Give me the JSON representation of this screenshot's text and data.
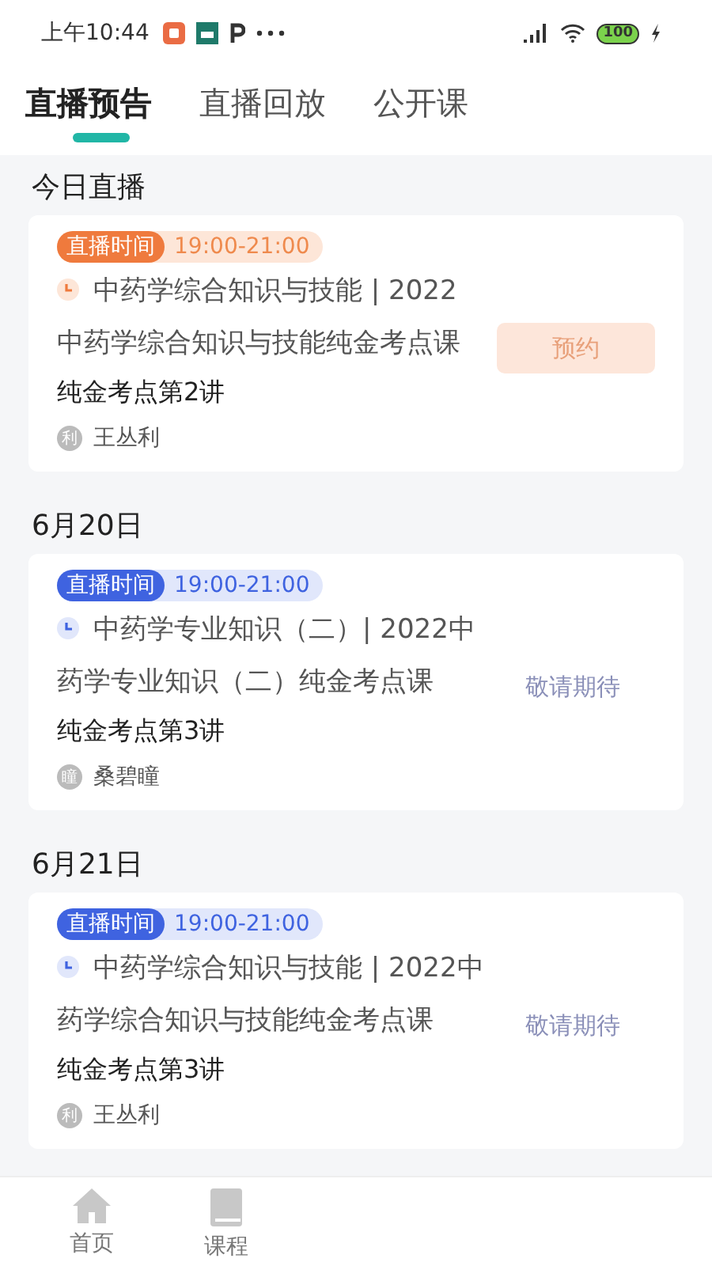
{
  "status_bar": {
    "time": "上午10:44",
    "battery": "100"
  },
  "tabs": [
    {
      "label": "直播预告",
      "selected": true
    },
    {
      "label": "直播回放",
      "selected": false
    },
    {
      "label": "公开课",
      "selected": false
    }
  ],
  "sections": [
    {
      "title": "今日直播",
      "lessons": [
        {
          "kind": "bookable",
          "tag": "直播时间",
          "time": "19:00-21:00",
          "course": "中药学综合知识与技能 | 2022中药学综合知识与技能纯金考点课",
          "lecture": "纯金考点第2讲",
          "avatar": "利",
          "teacher": "王丛利",
          "action": "预约"
        }
      ]
    },
    {
      "title": "6月20日",
      "lessons": [
        {
          "kind": "upcoming",
          "tag": "直播时间",
          "time": "19:00-21:00",
          "course": "中药学专业知识（二）| 2022中药学专业知识（二）纯金考点课",
          "lecture": "纯金考点第3讲",
          "avatar": "瞳",
          "teacher": "桑碧瞳",
          "action": "敬请期待"
        }
      ]
    },
    {
      "title": "6月21日",
      "lessons": [
        {
          "kind": "upcoming",
          "tag": "直播时间",
          "time": "19:00-21:00",
          "course": "中药学综合知识与技能 | 2022中药学综合知识与技能纯金考点课",
          "lecture": "纯金考点第3讲",
          "avatar": "利",
          "teacher": "王丛利",
          "action": "敬请期待"
        }
      ]
    }
  ],
  "bottom_nav": [
    {
      "kind": "home",
      "label": "首页",
      "selected": false
    },
    {
      "kind": "book",
      "label": "课程",
      "selected": false
    }
  ]
}
